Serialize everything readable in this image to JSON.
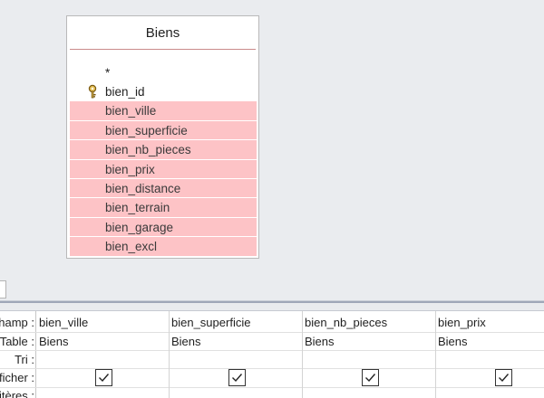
{
  "table": {
    "title": "Biens",
    "all_fields": "*",
    "primary_key": "bien_id",
    "key_icon": "key-icon",
    "selected_fields": [
      "bien_ville",
      "bien_superficie",
      "bien_nb_pieces",
      "bien_prix",
      "bien_distance",
      "bien_terrain",
      "bien_garage",
      "bien_excl"
    ],
    "selection_color": "#fdc3c6"
  },
  "grid": {
    "row_labels": [
      "hamp :",
      "Table :",
      "Tri :",
      "fficher :",
      "itères :"
    ],
    "columns": [
      {
        "champ": "bien_ville",
        "table": "Biens",
        "afficher": true
      },
      {
        "champ": "bien_superficie",
        "table": "Biens",
        "afficher": true
      },
      {
        "champ": "bien_nb_pieces",
        "table": "Biens",
        "afficher": true
      },
      {
        "champ": "bien_prix",
        "table": "Biens",
        "afficher": true
      }
    ]
  }
}
